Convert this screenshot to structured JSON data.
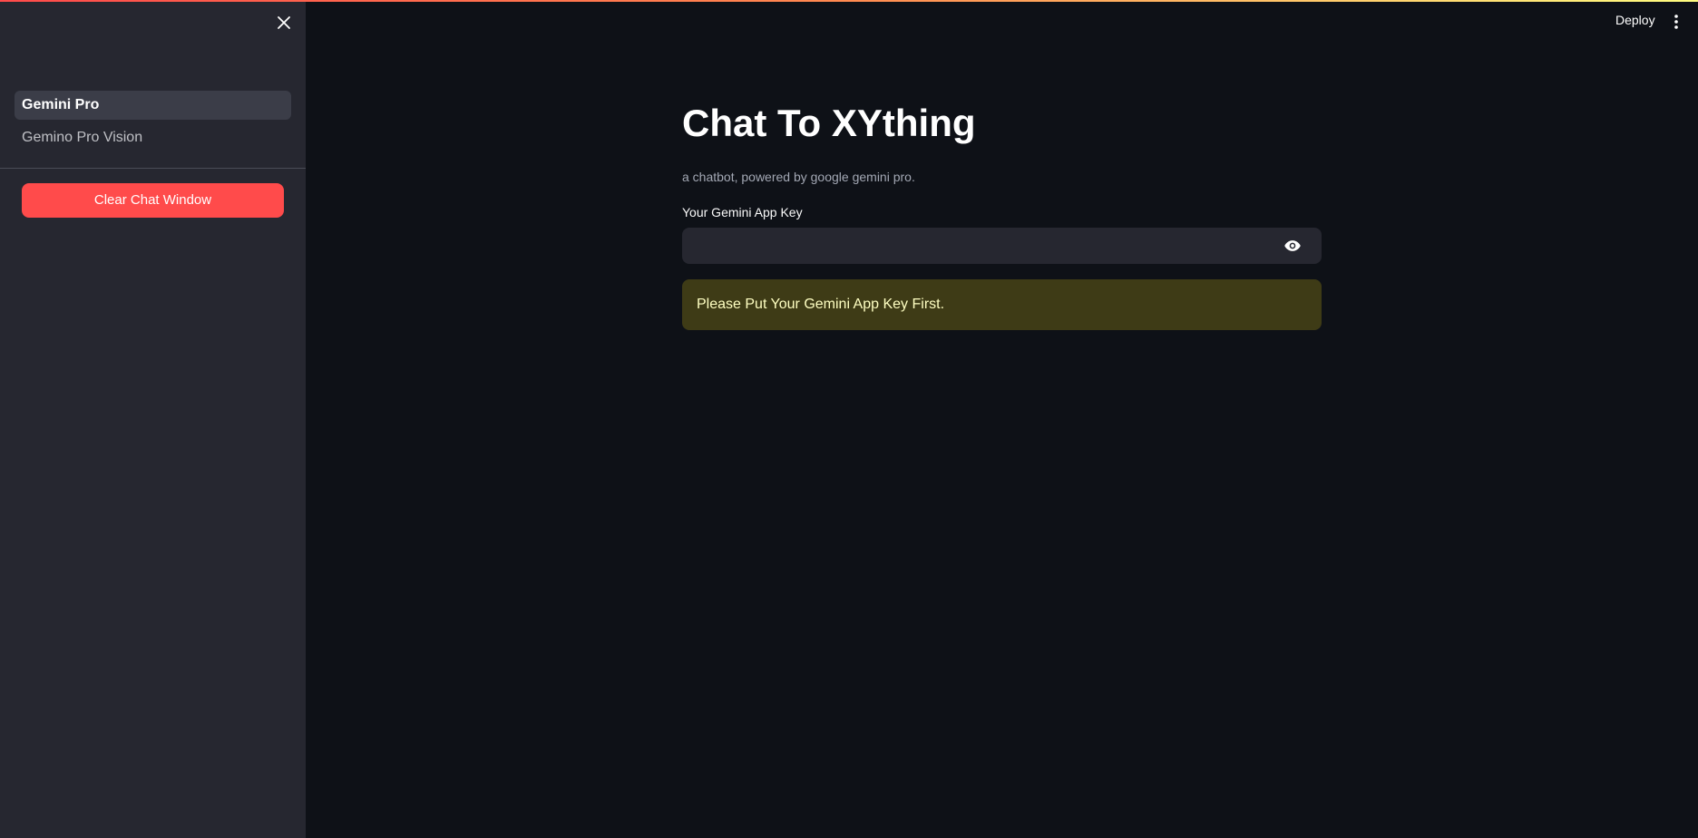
{
  "header": {
    "deploy_label": "Deploy"
  },
  "sidebar": {
    "items": [
      {
        "label": "Gemini Pro",
        "active": true
      },
      {
        "label": "Gemino Pro Vision",
        "active": false
      }
    ],
    "clear_button_label": "Clear Chat Window"
  },
  "main": {
    "title": "Chat To XYthing",
    "subtitle": "a chatbot, powered by google gemini pro.",
    "key_field": {
      "label": "Your Gemini App Key",
      "value": ""
    },
    "warning": "Please Put Your Gemini App Key First."
  },
  "icons": {
    "close": "close-icon",
    "kebab": "kebab-menu-icon",
    "eye": "eye-icon"
  },
  "colors": {
    "accent": "#ff4b4b",
    "background": "#0e1117",
    "sidebar": "#262730",
    "warning_bg": "#3e3b16",
    "warning_text": "#ffffc2"
  }
}
